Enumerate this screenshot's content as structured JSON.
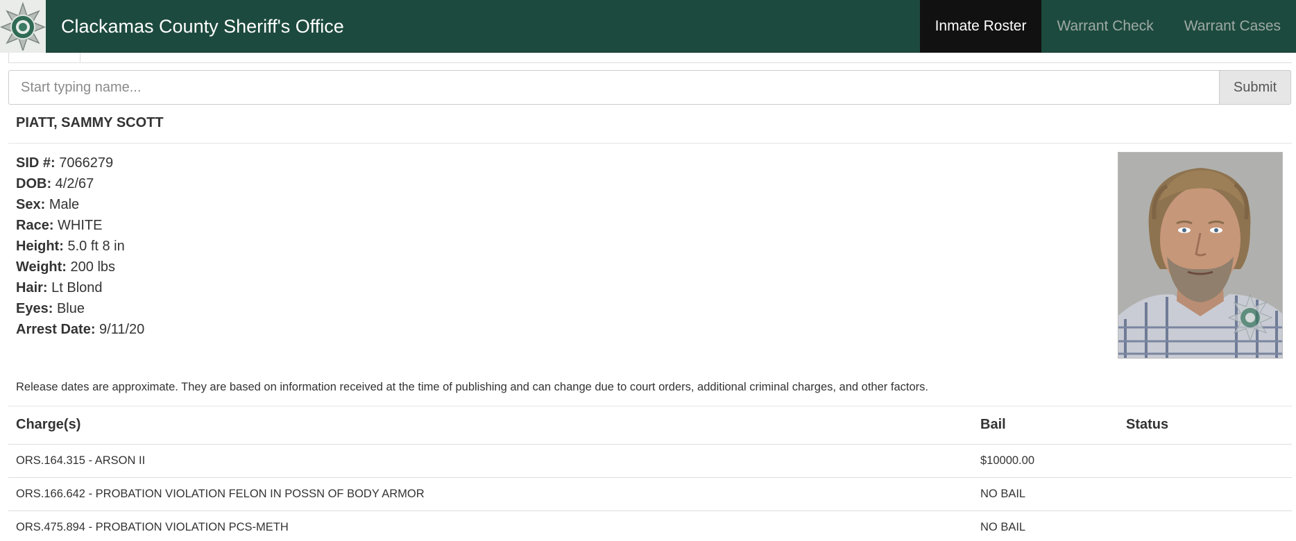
{
  "app": {
    "title": "Clackamas County Sheriff's Office"
  },
  "nav": [
    {
      "label": "Inmate Roster",
      "active": true
    },
    {
      "label": "Warrant Check",
      "active": false
    },
    {
      "label": "Warrant Cases",
      "active": false
    }
  ],
  "search": {
    "placeholder": "Start typing name...",
    "value": "",
    "submit_label": "Submit"
  },
  "inmate": {
    "name": "PIATT, SAMMY SCOTT",
    "fields": [
      {
        "label": "SID #:",
        "value": "7066279"
      },
      {
        "label": "DOB:",
        "value": "4/2/67"
      },
      {
        "label": "Sex:",
        "value": "Male"
      },
      {
        "label": "Race:",
        "value": "WHITE"
      },
      {
        "label": "Height:",
        "value": "5.0 ft 8 in"
      },
      {
        "label": "Weight:",
        "value": "200 lbs"
      },
      {
        "label": "Hair:",
        "value": "Lt Blond"
      },
      {
        "label": "Eyes:",
        "value": "Blue"
      },
      {
        "label": "Arrest Date:",
        "value": "9/11/20"
      }
    ]
  },
  "notice": "Release dates are approximate. They are based on information received at the time of publishing and can change due to court orders, additional criminal charges, and other factors.",
  "charges": {
    "headers": {
      "charge": "Charge(s)",
      "bail": "Bail",
      "status": "Status"
    },
    "rows": [
      {
        "charge": "ORS.164.315 - ARSON II",
        "bail": "$10000.00",
        "status": ""
      },
      {
        "charge": "ORS.166.642 - PROBATION VIOLATION FELON IN POSSN OF BODY ARMOR",
        "bail": "NO BAIL",
        "status": ""
      },
      {
        "charge": "ORS.475.894 - PROBATION VIOLATION PCS-METH",
        "bail": "NO BAIL",
        "status": ""
      }
    ]
  },
  "colors": {
    "navbar": "#1d4a3e",
    "nav_active": "#111111",
    "nav_inactive_text": "#9daaa5"
  },
  "icons": {
    "logo": "sheriff-star-badge-icon",
    "photo_watermark": "sheriff-star-badge-icon"
  }
}
